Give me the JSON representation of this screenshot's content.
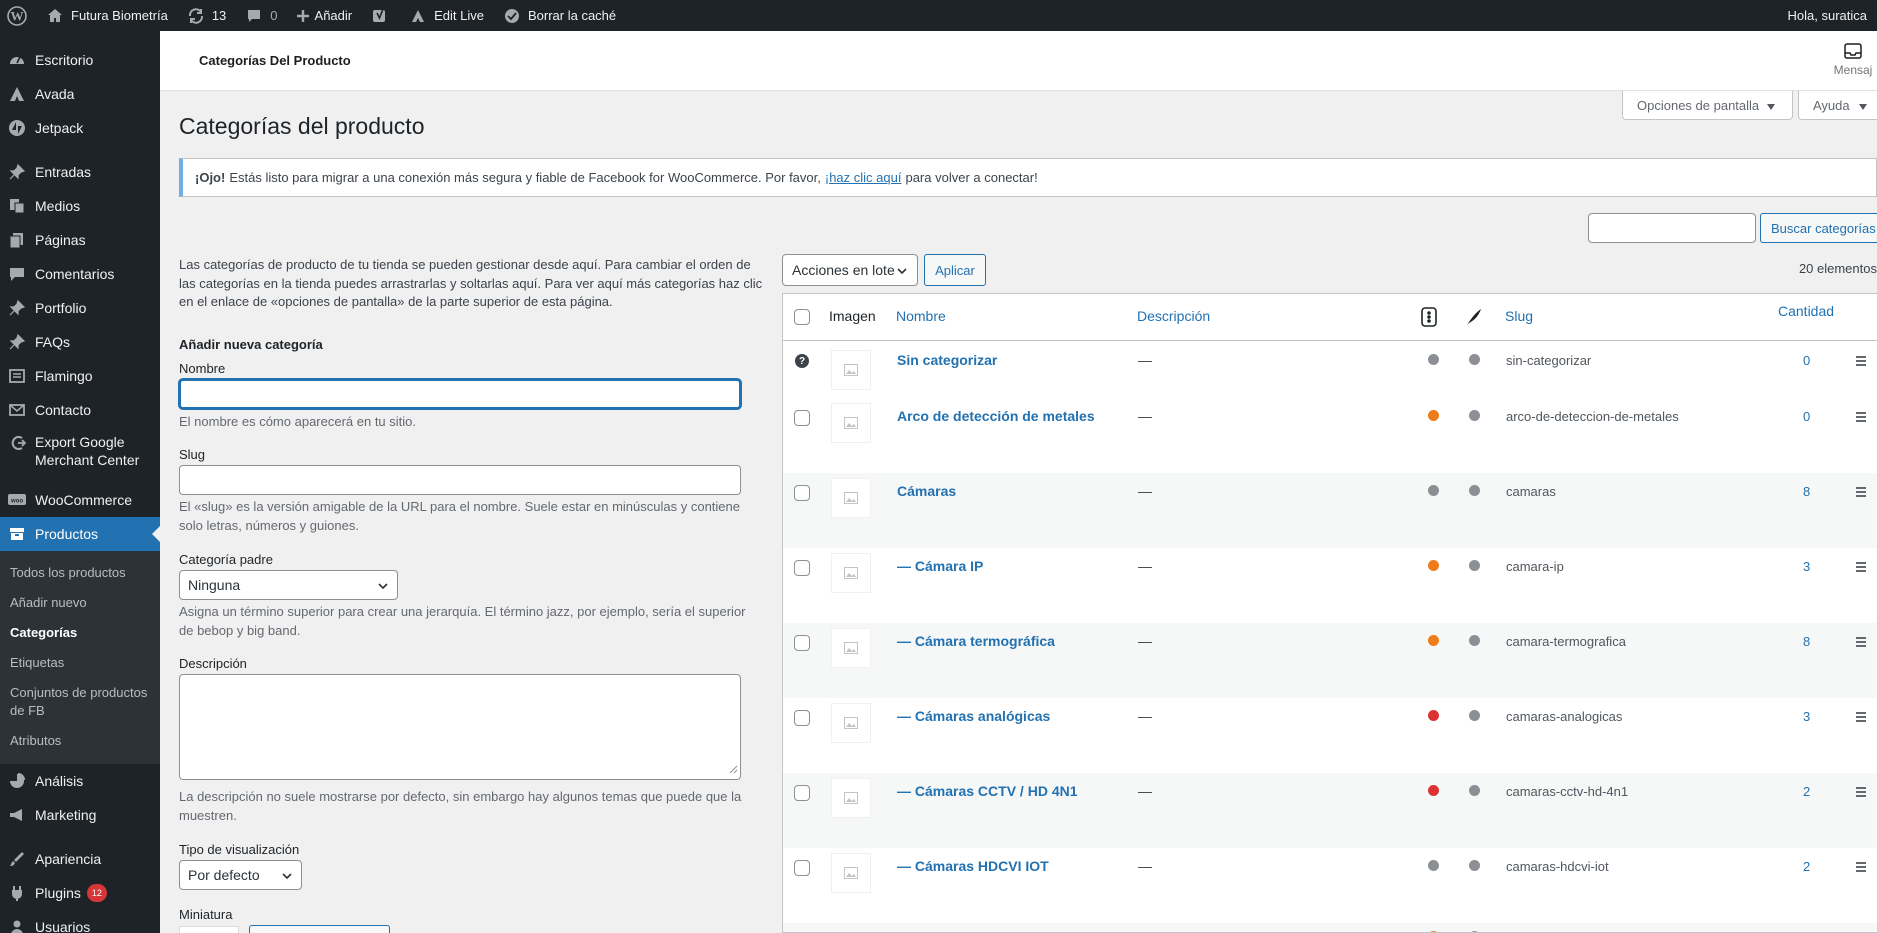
{
  "adminbar": {
    "site_name": "Futura Biometría",
    "updates_count": "13",
    "comments_count": "0",
    "new_label": "Añadir",
    "edit_live": "Edit Live",
    "clear_cache": "Borrar la caché",
    "greeting": "Hola, suratica"
  },
  "sidebar": {
    "items": [
      {
        "label": "Escritorio",
        "icon": "dashboard-icon"
      },
      {
        "label": "Avada",
        "icon": "avada-icon"
      },
      {
        "label": "Jetpack",
        "icon": "jetpack-icon"
      },
      {
        "label": "Entradas",
        "icon": "pin-icon"
      },
      {
        "label": "Medios",
        "icon": "media-icon"
      },
      {
        "label": "Páginas",
        "icon": "pages-icon"
      },
      {
        "label": "Comentarios",
        "icon": "comments-icon"
      },
      {
        "label": "Portfolio",
        "icon": "pin-icon"
      },
      {
        "label": "FAQs",
        "icon": "pin-icon"
      },
      {
        "label": "Flamingo",
        "icon": "flamingo-icon"
      },
      {
        "label": "Contacto",
        "icon": "mail-icon"
      },
      {
        "label": "Export Google Merchant Center",
        "icon": "export-icon"
      },
      {
        "label": "WooCommerce",
        "icon": "woocommerce-icon"
      },
      {
        "label": "Productos",
        "icon": "products-icon"
      }
    ],
    "submenu": [
      "Todos los productos",
      "Añadir nuevo",
      "Categorías",
      "Etiquetas",
      "Conjuntos de productos de FB",
      "Atributos"
    ],
    "after": [
      {
        "label": "Análisis",
        "icon": "analytics-icon"
      },
      {
        "label": "Marketing",
        "icon": "marketing-icon"
      },
      {
        "label": "Apariencia",
        "icon": "appearance-icon"
      },
      {
        "label": "Plugins",
        "icon": "plugins-icon",
        "badge": "12"
      },
      {
        "label": "Usuarios",
        "icon": "users-icon"
      }
    ]
  },
  "header": {
    "title": "Categorías Del Producto",
    "inbox_label": "Mensaj"
  },
  "screen_options": {
    "label": "Opciones de pantalla",
    "help": "Ayuda"
  },
  "page": {
    "title": "Categorías del producto"
  },
  "notice": {
    "bold": "¡Ojo!",
    "text_before": "Estás listo para migrar a una conexión más segura y fiable de Facebook for WooCommerce. Por favor,",
    "link": "¡haz clic aquí",
    "text_after": "para volver a conectar!"
  },
  "search": {
    "button": "Buscar categorías",
    "value": ""
  },
  "form": {
    "intro": "Las categorías de producto de tu tienda se pueden gestionar desde aquí. Para cambiar el orden de las categorías en la tienda puedes arrastrarlas y soltarlas aquí. Para ver aquí más categorías haz clic en el enlace de «opciones de pantalla» de la parte superior de esta página.",
    "heading": "Añadir nueva categoría",
    "name_label": "Nombre",
    "name_help": "El nombre es cómo aparecerá en tu sitio.",
    "slug_label": "Slug",
    "slug_help": "El «slug» es la versión amigable de la URL para el nombre. Suele estar en minúsculas y contiene solo letras, números y guiones.",
    "parent_label": "Categoría padre",
    "parent_value": "Ninguna",
    "parent_help": "Asigna un término superior para crear una jerarquía. El término jazz, por ejemplo, sería el superior de bebop y big band.",
    "desc_label": "Descripción",
    "desc_help": "La descripción no suele mostrarse por defecto, sin embargo hay algunos temas que puede que la muestren.",
    "display_label": "Tipo de visualización",
    "display_value": "Por defecto",
    "thumb_label": "Miniatura"
  },
  "table": {
    "bulk_label": "Acciones en lote",
    "apply_label": "Aplicar",
    "item_count": "20 elementos",
    "columns": {
      "image": "Imagen",
      "name": "Nombre",
      "description": "Descripción",
      "slug": "Slug",
      "count": "Cantidad"
    },
    "rows": [
      {
        "name": "Sin categorizar",
        "desc": "—",
        "seo": "#8c8f94",
        "readability": "#8c8f94",
        "slug": "sin-categorizar",
        "count": "0"
      },
      {
        "name": "Arco de detección de metales",
        "desc": "—",
        "seo": "#ee7c1b",
        "readability": "#8c8f94",
        "slug": "arco-de-deteccion-de-metales",
        "count": "0"
      },
      {
        "name": "Cámaras",
        "desc": "—",
        "seo": "#8c8f94",
        "readability": "#8c8f94",
        "slug": "camaras",
        "count": "8"
      },
      {
        "name": "— Cámara IP",
        "desc": "—",
        "seo": "#ee7c1b",
        "readability": "#8c8f94",
        "slug": "camara-ip",
        "count": "3"
      },
      {
        "name": "— Cámara termográfica",
        "desc": "—",
        "seo": "#ee7c1b",
        "readability": "#8c8f94",
        "slug": "camara-termografica",
        "count": "8"
      },
      {
        "name": "— Cámaras analógicas",
        "desc": "—",
        "seo": "#dc3232",
        "readability": "#8c8f94",
        "slug": "camaras-analogicas",
        "count": "3"
      },
      {
        "name": "— Cámaras CCTV / HD 4N1",
        "desc": "—",
        "seo": "#dc3232",
        "readability": "#8c8f94",
        "slug": "camaras-cctv-hd-4n1",
        "count": "2"
      },
      {
        "name": "— Cámaras HDCVI IOT",
        "desc": "—",
        "seo": "#8c8f94",
        "readability": "#8c8f94",
        "slug": "camaras-hdcvi-iot",
        "count": "2"
      }
    ]
  }
}
